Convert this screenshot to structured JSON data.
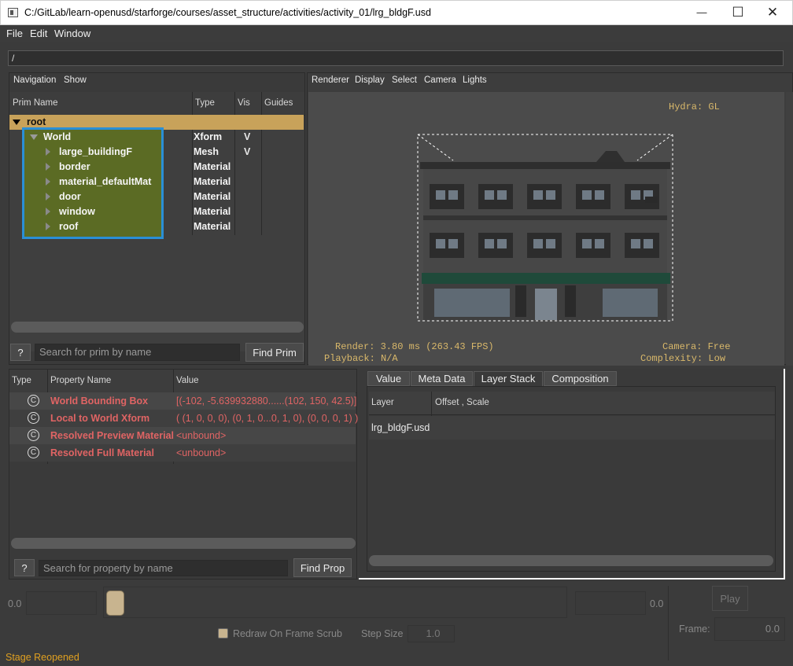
{
  "window": {
    "title": "C:/GitLab/learn-openusd/starforge/courses/asset_structure/activities/activity_01/lrg_bldgF.usd",
    "minimize_glyph": "—",
    "maximize_glyph": "☐",
    "close_glyph": "✕"
  },
  "menu": {
    "file": "File",
    "edit": "Edit",
    "window": "Window"
  },
  "path": "/",
  "navigation": {
    "toolbar": [
      "Navigation",
      "Show"
    ],
    "headers": {
      "name": "Prim Name",
      "type": "Type",
      "vis": "Vis",
      "guides": "Guides"
    },
    "rows": [
      {
        "name": "root",
        "type": "",
        "vis": ""
      },
      {
        "name": "World",
        "type": "Xform",
        "vis": "V"
      },
      {
        "name": "large_buildingF",
        "type": "Mesh",
        "vis": "V"
      },
      {
        "name": "border",
        "type": "Material",
        "vis": ""
      },
      {
        "name": "material_defaultMat",
        "type": "Material",
        "vis": ""
      },
      {
        "name": "door",
        "type": "Material",
        "vis": ""
      },
      {
        "name": "window",
        "type": "Material",
        "vis": ""
      },
      {
        "name": "roof",
        "type": "Material",
        "vis": ""
      }
    ],
    "help_label": "?",
    "search_placeholder": "Search for prim by name",
    "find_label": "Find Prim"
  },
  "viewport": {
    "toolbar": [
      "Renderer",
      "Display",
      "Select",
      "Camera",
      "Lights"
    ],
    "hydra": "Hydra: GL",
    "render": "Render: 3.80 ms (263.43 FPS)",
    "playback": "Playback: N/A",
    "camera": "Camera: Free",
    "complexity": "Complexity: Low"
  },
  "properties": {
    "headers": {
      "type": "Type",
      "name": "Property Name",
      "value": "Value"
    },
    "rows": [
      {
        "icon": "C",
        "name": "World Bounding Box",
        "value": "[(-102, -5.639932880......(102, 150, 42.5)]"
      },
      {
        "icon": "C",
        "name": "Local to World Xform",
        "value": "( (1, 0, 0, 0), (0, 1, 0...0, 1, 0), (0, 0, 0, 1) )"
      },
      {
        "icon": "C",
        "name": "Resolved Preview Material",
        "value": "<unbound>"
      },
      {
        "icon": "C",
        "name": "Resolved Full Material",
        "value": "<unbound>"
      }
    ],
    "help_label": "?",
    "search_placeholder": "Search for property by name",
    "find_label": "Find Prop"
  },
  "inspector": {
    "tabs": [
      "Value",
      "Meta Data",
      "Layer Stack",
      "Composition"
    ],
    "active_tab": "Layer Stack",
    "headers": {
      "layer": "Layer",
      "offset": "Offset , Scale"
    },
    "rows": [
      {
        "layer": "lrg_bldgF.usd",
        "offset": ""
      }
    ]
  },
  "timeline": {
    "start": "0.0",
    "end": "0.0",
    "redraw_label": "Redraw On Frame Scrub",
    "step_label": "Step Size",
    "step_value": "1.0",
    "play_label": "Play",
    "frame_label": "Frame:",
    "frame_value": "0.0"
  },
  "status": "Stage Reopened",
  "colors": {
    "accent_gold": "#c8a25a",
    "highlight_blue": "#2a8fd6",
    "selection_green": "#5b6b24",
    "property_red": "#e06464"
  }
}
